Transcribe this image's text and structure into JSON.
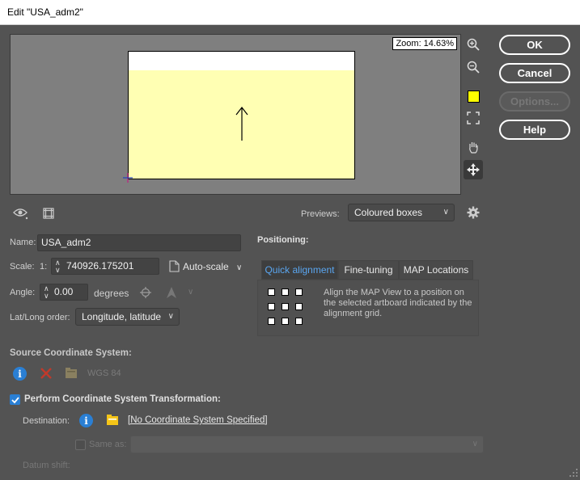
{
  "window": {
    "title": "Edit \"USA_adm2\""
  },
  "preview": {
    "zoom_label": "Zoom: 14.63%",
    "previews_label": "Previews:",
    "previews_value": "Coloured boxes"
  },
  "buttons": {
    "ok": "OK",
    "cancel": "Cancel",
    "options": "Options...",
    "help": "Help"
  },
  "form": {
    "name_label": "Name:",
    "name_value": "USA_adm2",
    "scale_label": "Scale:",
    "scale_prefix": "1:",
    "scale_value": "740926.175201",
    "autoscale_label": "Auto-scale",
    "angle_label": "Angle:",
    "angle_value": "0.00",
    "angle_unit": "degrees",
    "latlong_label": "Lat/Long order:",
    "latlong_value": "Longitude, latitude"
  },
  "positioning": {
    "heading": "Positioning:",
    "tabs": [
      "Quick alignment",
      "Fine-tuning",
      "MAP Locations"
    ],
    "active_tab": "Quick alignment",
    "description": "Align the MAP View to a position on the selected artboard indicated by the alignment grid."
  },
  "source": {
    "heading": "Source Coordinate System:",
    "value": "WGS 84"
  },
  "transform": {
    "checkbox_label": "Perform Coordinate System Transformation:",
    "checked": true,
    "destination_label": "Destination:",
    "destination_value": "[No Coordinate System Specified]",
    "same_as_label": "Same as:",
    "datum_label": "Datum shift:"
  },
  "colors": {
    "accent": "#2a7fd4",
    "artboard_fill": "#ffffb3",
    "swatch": "#ffff00"
  }
}
